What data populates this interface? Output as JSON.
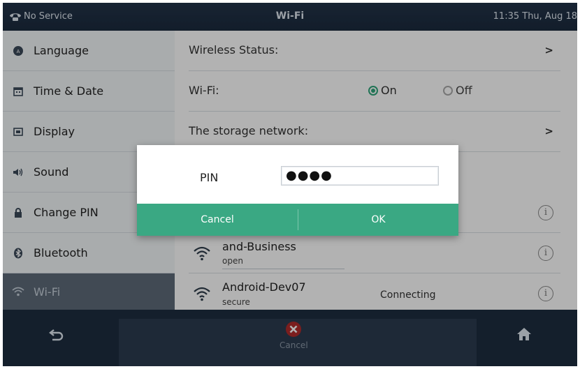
{
  "status_bar": {
    "left": "No Service",
    "title": "Wi-Fi",
    "right": "11:35 Thu, Aug 18"
  },
  "sidebar": {
    "items": [
      {
        "label": "Language",
        "icon": "globe-icon"
      },
      {
        "label": "Time & Date",
        "icon": "calendar-icon"
      },
      {
        "label": "Display",
        "icon": "display-icon"
      },
      {
        "label": "Sound",
        "icon": "speaker-icon"
      },
      {
        "label": "Change PIN",
        "icon": "lock-icon"
      },
      {
        "label": "Bluetooth",
        "icon": "bluetooth-icon"
      },
      {
        "label": "Wi-Fi",
        "icon": "wifi-icon",
        "active": true
      }
    ]
  },
  "main": {
    "wireless_status": "Wireless Status:",
    "wifi_label": "Wi-Fi:",
    "wifi_on": "On",
    "wifi_off": "Off",
    "wifi_selected": "On",
    "storage_network": "The storage network:",
    "chevron": ">",
    "info_glyph": "i",
    "networks": [
      {
        "name": "and-Business",
        "security": "open",
        "status": ""
      },
      {
        "name": "Android-Dev07",
        "security": "secure",
        "status": "Connecting"
      }
    ]
  },
  "dialog": {
    "pin_label": "PIN",
    "pin_value": "●●●●",
    "cancel_label": "Cancel",
    "ok_label": "OK"
  },
  "bottom_bar": {
    "center_label": "Cancel"
  },
  "colors": {
    "accent": "#3aa883",
    "status_bar": "#1b2a3d",
    "bottom_bar": "#1e2d40",
    "sidebar_active": "#5e6b79"
  }
}
